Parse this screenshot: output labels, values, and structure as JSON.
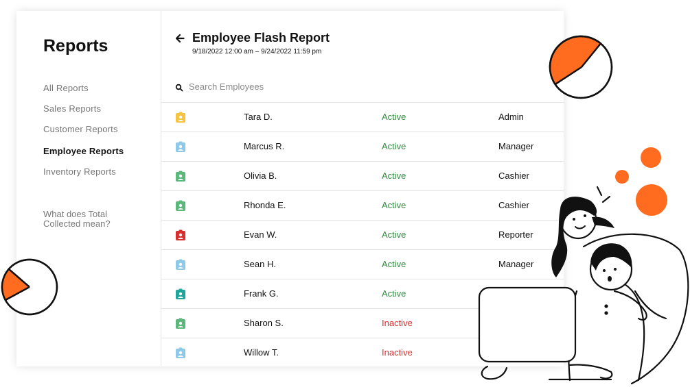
{
  "sidebar": {
    "title": "Reports",
    "items": [
      {
        "label": "All Reports",
        "active": false
      },
      {
        "label": "Sales Reports",
        "active": false
      },
      {
        "label": "Customer Reports",
        "active": false
      },
      {
        "label": "Employee Reports",
        "active": true
      },
      {
        "label": "Inventory Reports",
        "active": false
      }
    ],
    "help": "What does Total Collected mean?"
  },
  "report": {
    "title": "Employee Flash Report",
    "date_range": "9/18/2022 12:00 am – 9/24/2022 11:59 pm"
  },
  "search": {
    "placeholder": "Search Employees",
    "value": ""
  },
  "colors": {
    "accent": "#ff6b1f",
    "active": "#2e8b3e",
    "inactive": "#d9302f"
  },
  "employees": [
    {
      "name": "Tara D.",
      "status": "Active",
      "role": "Admin",
      "badge_color": "#f6c343"
    },
    {
      "name": "Marcus R.",
      "status": "Active",
      "role": "Manager",
      "badge_color": "#8ec9e8"
    },
    {
      "name": "Olivia B.",
      "status": "Active",
      "role": "Cashier",
      "badge_color": "#5cb87a"
    },
    {
      "name": "Rhonda E.",
      "status": "Active",
      "role": "Cashier",
      "badge_color": "#5cb87a"
    },
    {
      "name": "Evan W.",
      "status": "Active",
      "role": "Reporter",
      "badge_color": "#d9302f"
    },
    {
      "name": "Sean H.",
      "status": "Active",
      "role": "Manager",
      "badge_color": "#8ec9e8"
    },
    {
      "name": "Frank G.",
      "status": "Active",
      "role": "",
      "badge_color": "#1fa59a"
    },
    {
      "name": "Sharon S.",
      "status": "Inactive",
      "role": "",
      "badge_color": "#5cb87a"
    },
    {
      "name": "Willow T.",
      "status": "Inactive",
      "role": "",
      "badge_color": "#8ec9e8"
    }
  ]
}
